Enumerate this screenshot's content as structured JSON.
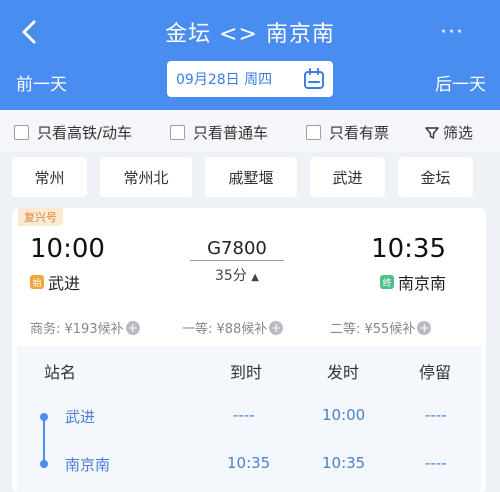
{
  "header": {
    "title": "金坛 <> 南京南",
    "prev_day": "前一天",
    "next_day": "后一天",
    "date": "09月28日 周四",
    "more": "···"
  },
  "filters": {
    "high_speed": "只看高铁/动车",
    "normal": "只看普通车",
    "has_ticket": "只看有票",
    "filter": "筛选"
  },
  "stations": [
    "常州",
    "常州北",
    "戚墅堰",
    "武进",
    "金坛"
  ],
  "train": {
    "badge": "复兴号",
    "dep_time": "10:00",
    "arr_time": "10:35",
    "number": "G7800",
    "duration": "35分",
    "dep_station": "武进",
    "arr_station": "南京南",
    "dep_tag": "始",
    "arr_tag": "终",
    "seats": [
      {
        "label": "商务: ¥193候补"
      },
      {
        "label": "一等: ¥88候补"
      },
      {
        "label": "二等: ¥55候补"
      }
    ]
  },
  "schedule": {
    "headers": [
      "站名",
      "到时",
      "发时",
      "停留"
    ],
    "rows": [
      {
        "station": "武进",
        "arrive": "----",
        "depart": "10:00",
        "stop": "----"
      },
      {
        "station": "南京南",
        "arrive": "10:35",
        "depart": "10:35",
        "stop": "----"
      }
    ]
  },
  "colors": {
    "header_blue": "#4a8df0",
    "accent_blue": "#3b7de8",
    "badge_orange": "#d4873a",
    "tag_start": "#f0a63a",
    "tag_end": "#4cc08a"
  }
}
